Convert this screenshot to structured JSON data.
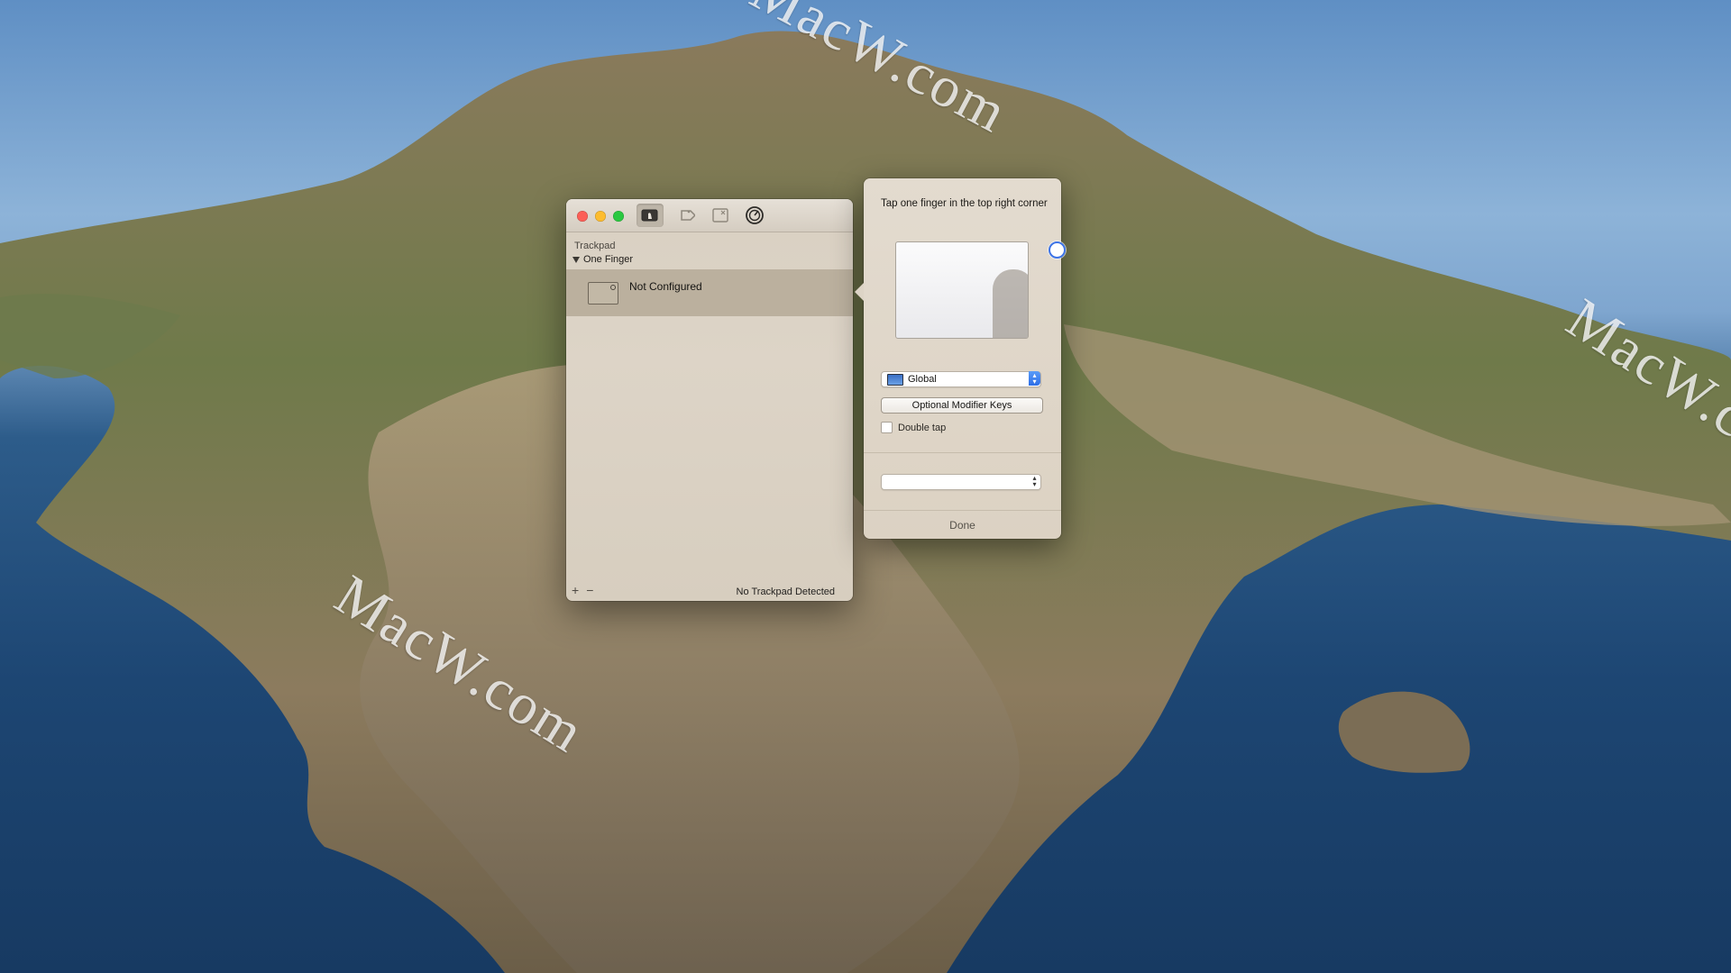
{
  "watermark": "MacW.com",
  "window": {
    "toolbar_icons": [
      "trackpad-icon",
      "tag-icon",
      "close-box-icon",
      "settings-dial-icon"
    ],
    "section_label": "Trackpad",
    "group_label": "One Finger",
    "gesture_rows": [
      {
        "label": "Not Configured",
        "selected": true
      }
    ],
    "footer": {
      "add": "+",
      "remove": "−",
      "status": "No Trackpad Detected"
    }
  },
  "popover": {
    "title": "Tap one finger in the top right corner",
    "scope_select": {
      "value": "Global",
      "icon": "monitor-icon"
    },
    "modifier_button": "Optional Modifier Keys",
    "double_tap_label": "Double tap",
    "double_tap_checked": false,
    "action_select": {
      "value": ""
    },
    "done_label": "Done"
  },
  "colors": {
    "accent": "#2d6ee6",
    "close": "#fc5f57",
    "minimize": "#fdbc2e",
    "maximize": "#2ac840"
  }
}
